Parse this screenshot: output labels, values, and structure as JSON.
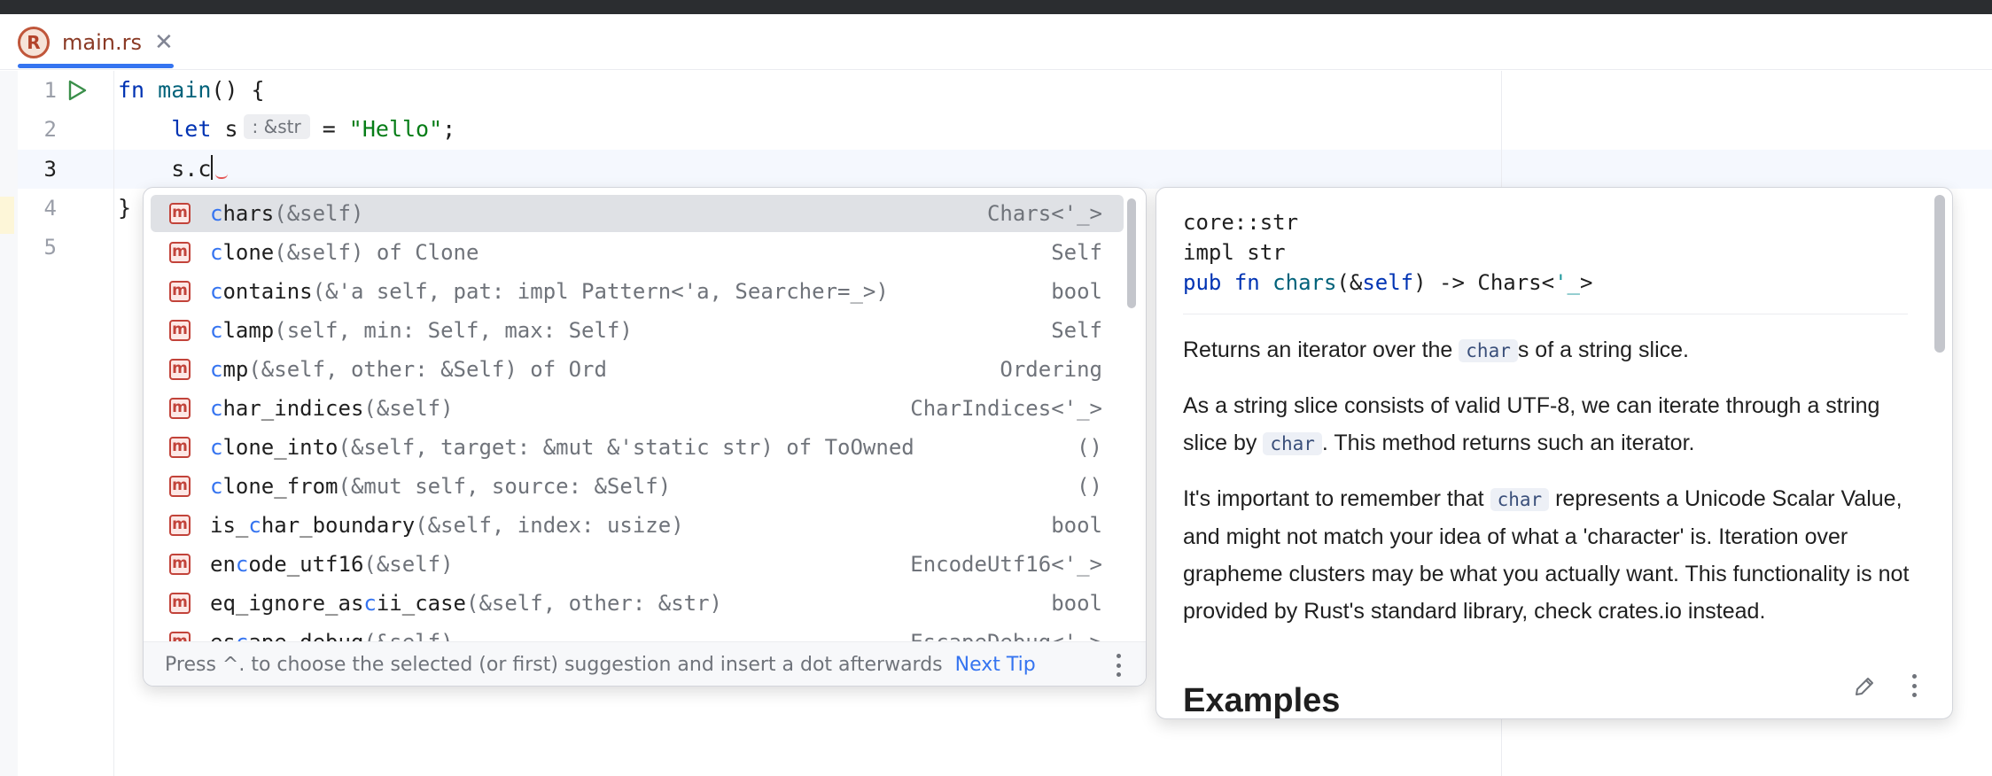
{
  "tab": {
    "icon": "rust-file-icon",
    "icon_letter": "R",
    "filename": "main.rs",
    "close_glyph": "✕"
  },
  "editor": {
    "line_numbers": [
      "1",
      "2",
      "3",
      "4",
      "5"
    ],
    "lines": {
      "l1_kw": "fn",
      "l1_fn": "main",
      "l1_rest": "() {",
      "l2_kw": "let",
      "l2_var": "s",
      "l2_hint": ": &str",
      "l2_eq": "= ",
      "l2_str": "\"Hello\"",
      "l2_end": ";",
      "l3": "s.c",
      "l4": "}"
    }
  },
  "completion": {
    "items": [
      {
        "match": "c",
        "rest": "hars",
        "params": "(&self)",
        "type": "Chars<'_>"
      },
      {
        "match": "c",
        "rest": "lone",
        "params": "(&self) of Clone",
        "type": "Self"
      },
      {
        "match": "c",
        "rest": "ontains",
        "params": "(&'a self, pat: impl Pattern<'a, Searcher=_>)",
        "type": "bool"
      },
      {
        "match": "c",
        "rest": "lamp",
        "params": "(self, min: Self, max: Self)",
        "type": "Self"
      },
      {
        "match": "c",
        "rest": "mp",
        "params": "(&self, other: &Self) of Ord",
        "type": "Ordering"
      },
      {
        "match": "c",
        "rest": "har_indices",
        "params": "(&self)",
        "type": "CharIndices<'_>"
      },
      {
        "match": "c",
        "rest": "lone_into",
        "params": "(&self, target: &mut &'static str) of ToOwned",
        "type": "()"
      },
      {
        "match": "c",
        "rest": "lone_from",
        "params": "(&mut self, source: &Self)",
        "type": "()"
      },
      {
        "pre": "is_",
        "match": "c",
        "rest": "har_boundary",
        "params": "(&self, index: usize)",
        "type": "bool"
      },
      {
        "pre": "en",
        "match": "c",
        "rest": "ode_utf16",
        "params": "(&self)",
        "type": "EncodeUtf16<'_>"
      },
      {
        "pre": "eq_ignore_as",
        "match": "c",
        "rest": "ii_case",
        "params": "(&self, other: &str)",
        "type": "bool"
      },
      {
        "pre": "es",
        "match": "c",
        "rest": "ape_debug",
        "params": "(&self)",
        "type": "EscapeDebug<'_>"
      }
    ],
    "item_icon": "method-icon",
    "item_icon_letter": "m",
    "footer_hint": "Press ^. to choose the selected (or first) suggestion and insert a dot afterwards",
    "footer_link": "Next Tip"
  },
  "doc": {
    "module": "core::str",
    "impl": "impl str",
    "sig_pub": "pub",
    "sig_fn": "fn",
    "sig_name": "chars",
    "sig_open": "(&",
    "sig_self": "self",
    "sig_mid": ") -> Chars<",
    "sig_lt": "'_",
    "sig_close": ">",
    "p1_a": "Returns an iterator over the ",
    "p1_code": "char",
    "p1_b": "s of a string slice.",
    "p2_a": "As a string slice consists of valid UTF-8, we can iterate through a string slice by ",
    "p2_code": "char",
    "p2_b": ". This method returns such an iterator.",
    "p3_a": "It's important to remember that ",
    "p3_code": "char",
    "p3_b": " represents a Unicode Scalar Value, and might not match your idea of what a 'character' is. Iteration over grapheme clusters may be what you actually want. This functionality is not provided by Rust's standard library, check crates.io instead.",
    "heading": "Examples"
  },
  "colors": {
    "accent": "#3574f0",
    "keyword": "#0033b3",
    "function": "#00627a",
    "string": "#067d17"
  }
}
